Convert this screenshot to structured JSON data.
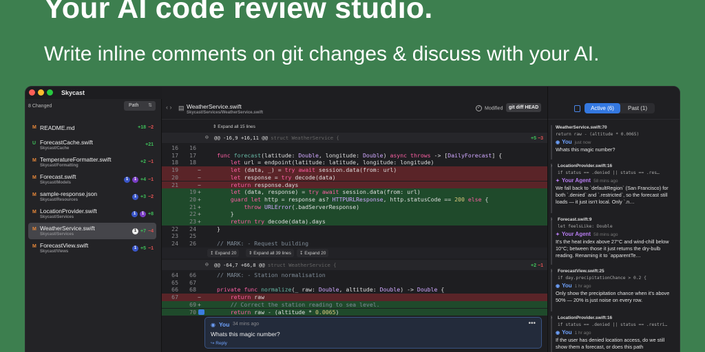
{
  "hero": {
    "title": "Your AI code review studio.",
    "subtitle": "Write inline comments on git changes & discuss with your AI."
  },
  "window": {
    "app_title": "Skycast",
    "traffic_lights": [
      "#ff5f57",
      "#febc2e",
      "#28c840"
    ]
  },
  "sidebar": {
    "changed_label": "8 Changed",
    "sort_label": "Path",
    "files": [
      {
        "status": "M",
        "status_color": "#e8883a",
        "name": "README.md",
        "path": "",
        "badges": [],
        "add": "+18",
        "del": "−2"
      },
      {
        "status": "U",
        "status_color": "#3fbf5a",
        "name": "ForecastCache.swift",
        "path": "Skycast/Cache",
        "badges": [],
        "add": "+21",
        "del": ""
      },
      {
        "status": "M",
        "status_color": "#e8883a",
        "name": "TemperatureFormatter.swift",
        "path": "Skycast/Formatting",
        "badges": [],
        "add": "+2",
        "del": "−1"
      },
      {
        "status": "M",
        "status_color": "#e8883a",
        "name": "Forecast.swift",
        "path": "Skycast/Models",
        "badges": [
          "1",
          "1"
        ],
        "add": "+4",
        "del": "−1"
      },
      {
        "status": "M",
        "status_color": "#e8883a",
        "name": "sample-response.json",
        "path": "Skycast/Resources",
        "badges": [
          "1"
        ],
        "add": "+3",
        "del": "−2"
      },
      {
        "status": "M",
        "status_color": "#e8883a",
        "name": "LocationProvider.swift",
        "path": "Skycast/Services",
        "badges": [
          "1",
          "1"
        ],
        "add": "+8",
        "del": ""
      },
      {
        "status": "M",
        "status_color": "#e8883a",
        "name": "WeatherService.swift",
        "path": "Skycast/Services",
        "badges": [
          "1"
        ],
        "add": "+7",
        "del": "−4"
      },
      {
        "status": "M",
        "status_color": "#e8883a",
        "name": "ForecastView.swift",
        "path": "Skycast/Views",
        "badges": [
          "1"
        ],
        "add": "+5",
        "del": "−1"
      }
    ]
  },
  "main": {
    "file_name": "WeatherService.swift",
    "file_path": "Skycast/Services/WeatherService.swift",
    "status": "Modified",
    "diff_cmd": "git diff HEAD",
    "expand_all_top": "Expand all 15 lines",
    "hunk1": {
      "header": "@@ -16,9 +16,11 @@",
      "context": "struct WeatherService {",
      "add": "+5",
      "del": "−3"
    },
    "hunk2": {
      "header": "@@ -64,7 +66,8 @@",
      "context": "struct WeatherService {",
      "add": "+2",
      "del": "−1"
    },
    "expand_up": "Expand 20",
    "expand_all_mid": "Expand all 39 lines",
    "expand_down": "Expand 20",
    "lines1": [
      {
        "type": "ctx",
        "old": "16",
        "new": "16",
        "sign": "",
        "code": ""
      },
      {
        "type": "ctx",
        "old": "17",
        "new": "17",
        "sign": "",
        "code": "func forecast(latitude: Double, longitude: Double) async throws -> [DailyForecast] {"
      },
      {
        "type": "ctx",
        "old": "18",
        "new": "18",
        "sign": "",
        "code": "    let url = endpoint(latitude: latitude, longitude: longitude)"
      },
      {
        "type": "del",
        "old": "19",
        "new": "",
        "sign": "−",
        "code": "    let (data, _) = try await session.data(from: url)"
      },
      {
        "type": "del",
        "old": "20",
        "new": "",
        "sign": "−",
        "code": "    let response = try decode(data)"
      },
      {
        "type": "del",
        "old": "21",
        "new": "",
        "sign": "−",
        "code": "    return response.days"
      },
      {
        "type": "add",
        "old": "",
        "new": "19",
        "sign": "+",
        "code": "    let (data, response) = try await session.data(from: url)"
      },
      {
        "type": "add",
        "old": "",
        "new": "20",
        "sign": "+",
        "code": "    guard let http = response as? HTTPURLResponse, http.statusCode == 200 else {"
      },
      {
        "type": "add",
        "old": "",
        "new": "21",
        "sign": "+",
        "code": "        throw URLError(.badServerResponse)"
      },
      {
        "type": "add",
        "old": "",
        "new": "22",
        "sign": "+",
        "code": "    }"
      },
      {
        "type": "add",
        "old": "",
        "new": "23",
        "sign": "+",
        "code": "    return try decode(data).days"
      },
      {
        "type": "ctx",
        "old": "22",
        "new": "24",
        "sign": "",
        "code": "}"
      },
      {
        "type": "ctx",
        "old": "23",
        "new": "25",
        "sign": "",
        "code": ""
      },
      {
        "type": "ctx",
        "old": "24",
        "new": "26",
        "sign": "",
        "code": "// MARK: - Request building"
      }
    ],
    "lines2": [
      {
        "type": "ctx",
        "old": "64",
        "new": "66",
        "sign": "",
        "code": "// MARK: - Station normalisation"
      },
      {
        "type": "ctx",
        "old": "65",
        "new": "67",
        "sign": "",
        "code": ""
      },
      {
        "type": "ctx",
        "old": "66",
        "new": "68",
        "sign": "",
        "code": "private func normalize(_ raw: Double, altitude: Double) -> Double {"
      },
      {
        "type": "del",
        "old": "67",
        "new": "",
        "sign": "−",
        "code": "    return raw"
      },
      {
        "type": "add",
        "old": "",
        "new": "69",
        "sign": "+",
        "code": "    // Correct the station reading to sea level."
      },
      {
        "type": "add",
        "old": "",
        "new": "70",
        "sign": "",
        "code": "    return raw - (altitude * 0.0065)"
      }
    ],
    "inline_comment": {
      "author": "You",
      "time": "34 mins ago",
      "text": "Whats this magic number?",
      "reply": "Reply"
    }
  },
  "right_panel": {
    "tab_active": "Active (6)",
    "tab_past": "Past (1)",
    "threads": [
      {
        "file": "WeatherService.swift:70",
        "code": "return raw - (altitude * 0.0065)",
        "who": "You",
        "who_type": "you",
        "time": "just now",
        "body": "Whats this magic number?"
      },
      {
        "file": "LocationProvider.swift:16",
        "code": "if status == .denied || status == .res…",
        "who": "Your Agent",
        "who_type": "agent",
        "time": "58 mins ago",
        "body": "We fall back to `defaultRegion` (San Francisco) for both `.denied` and `.restricted`, so the forecast still loads — it just isn't local. Only `.n…"
      },
      {
        "file": "Forecast.swift:9",
        "code": "let feelsLike: Double",
        "who": "Your Agent",
        "who_type": "agent",
        "time": "58 mins ago",
        "body": "It's the heat index above 27°C and wind-chill below 10°C; between those it just returns the dry-bulb reading. Renaming it to `apparentTe…"
      },
      {
        "file": "ForecastView.swift:25",
        "code": "if day.precipitationChance > 0.2 {",
        "who": "You",
        "who_type": "you",
        "time": "1 hr ago",
        "body": "Only show the precipitation chance when it's above 50% — 20% is just noise on every row."
      },
      {
        "file": "LocationProvider.swift:16",
        "code": "if status == .denied || status == .restri…",
        "who": "You",
        "who_type": "you",
        "time": "1 hr ago",
        "body": "If the user has denied location access, do we still show them a forecast, or does this path"
      }
    ]
  }
}
